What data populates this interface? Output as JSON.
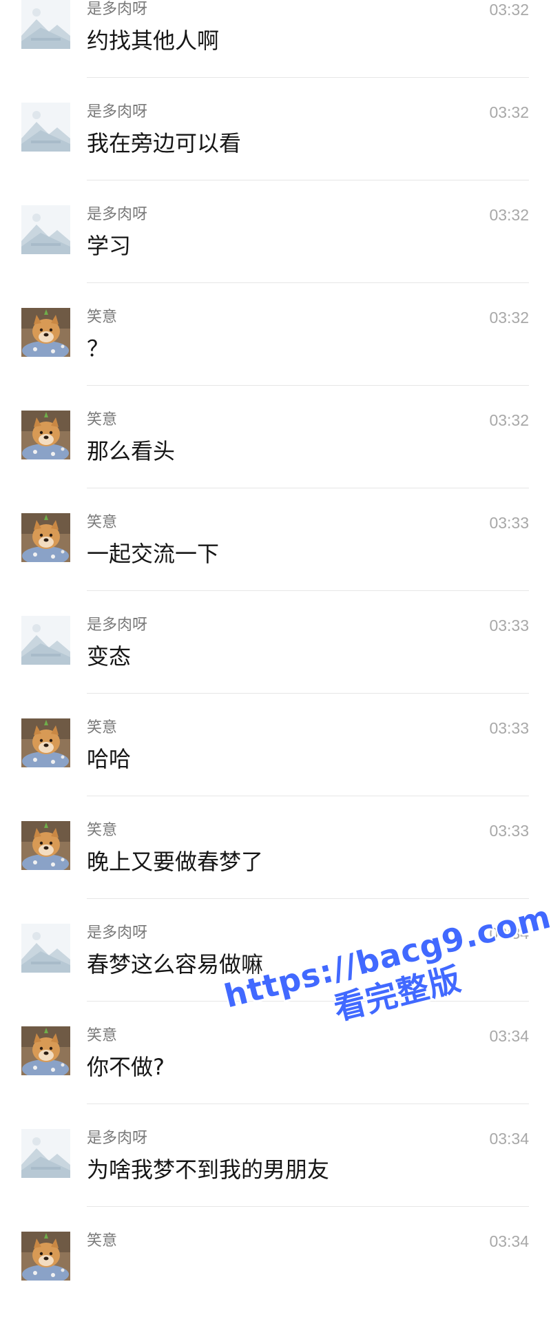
{
  "messages": [
    {
      "sender": "是多肉呀",
      "time": "03:32",
      "text": "约找其他人啊",
      "avatar": "placeholder"
    },
    {
      "sender": "是多肉呀",
      "time": "03:32",
      "text": "我在旁边可以看",
      "avatar": "placeholder"
    },
    {
      "sender": "是多肉呀",
      "time": "03:32",
      "text": "学习",
      "avatar": "placeholder"
    },
    {
      "sender": "笑意",
      "time": "03:32",
      "text": "？",
      "avatar": "dog"
    },
    {
      "sender": "笑意",
      "time": "03:32",
      "text": "那么看头",
      "avatar": "dog"
    },
    {
      "sender": "笑意",
      "time": "03:33",
      "text": "一起交流一下",
      "avatar": "dog"
    },
    {
      "sender": "是多肉呀",
      "time": "03:33",
      "text": "变态",
      "avatar": "placeholder"
    },
    {
      "sender": "笑意",
      "time": "03:33",
      "text": "哈哈",
      "avatar": "dog"
    },
    {
      "sender": "笑意",
      "time": "03:33",
      "text": "晚上又要做春梦了",
      "avatar": "dog"
    },
    {
      "sender": "是多肉呀",
      "time": "03:34",
      "text": "春梦这么容易做嘛",
      "avatar": "placeholder"
    },
    {
      "sender": "笑意",
      "time": "03:34",
      "text": "你不做?",
      "avatar": "dog"
    },
    {
      "sender": "是多肉呀",
      "time": "03:34",
      "text": "为啥我梦不到我的男朋友",
      "avatar": "placeholder"
    },
    {
      "sender": "笑意",
      "time": "03:34",
      "text": "",
      "avatar": "dog"
    }
  ],
  "watermark": {
    "url": "https://bacg9.com",
    "subtitle": "看完整版",
    "color": "#4169ff"
  },
  "icons": {
    "placeholder": "image-placeholder-icon",
    "dog": "dog-avatar-icon"
  }
}
